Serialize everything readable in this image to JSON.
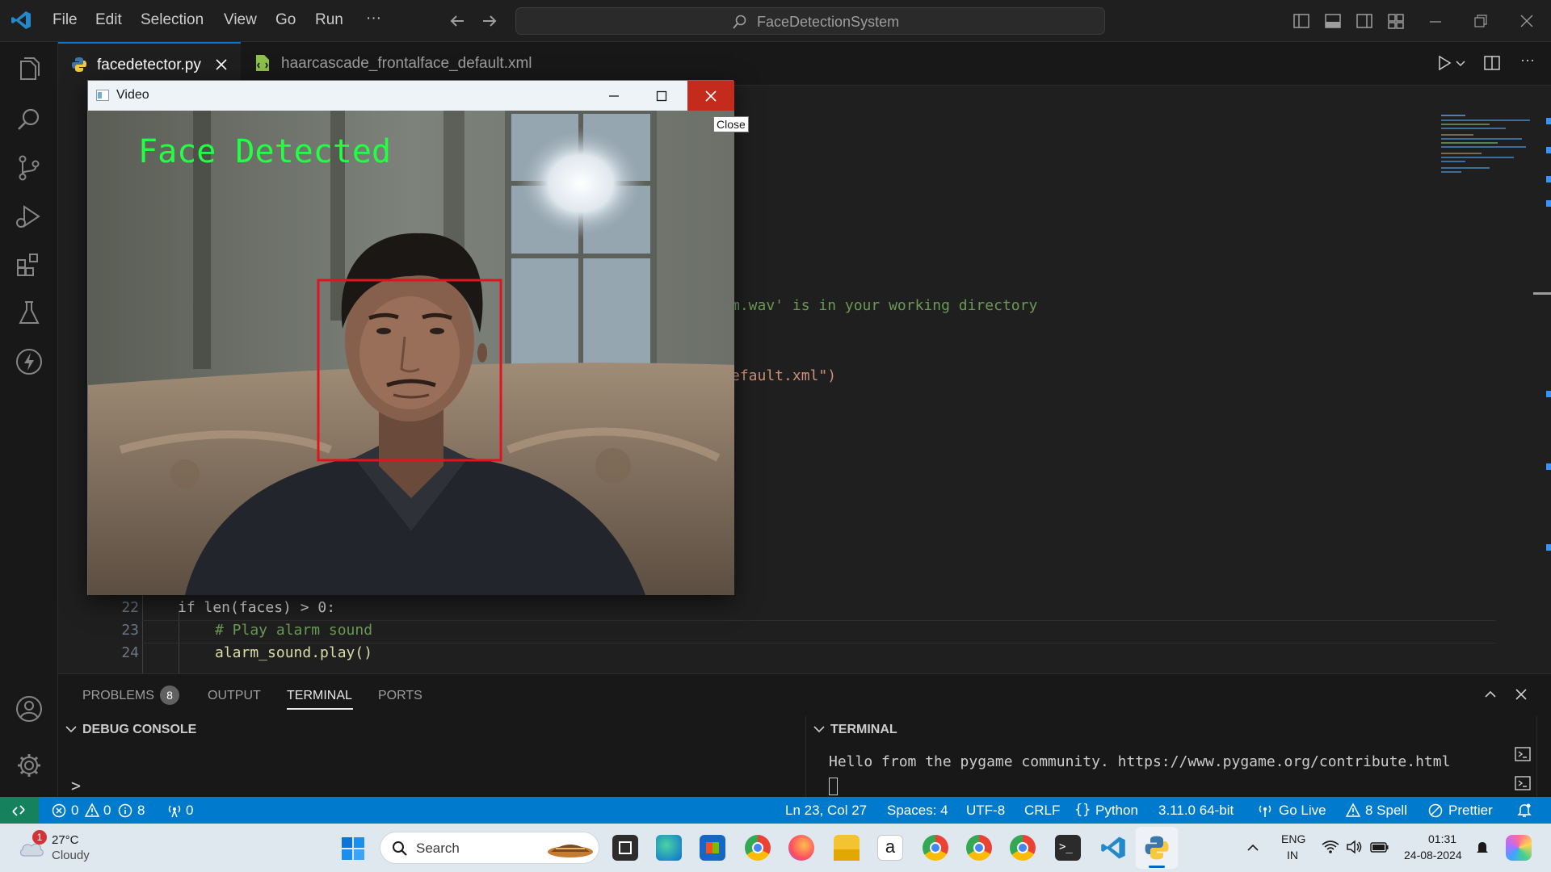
{
  "titlebar": {
    "menu": [
      "File",
      "Edit",
      "Selection",
      "View",
      "Go",
      "Run",
      "···"
    ],
    "search_text": "FaceDetectionSystem"
  },
  "tabs": [
    {
      "label": "facedetector.py",
      "active": true
    },
    {
      "label": "haarcascade_frontalface_default.xml",
      "active": false
    }
  ],
  "editor": {
    "visible_fragments": [
      "m.wav' is in your working directory",
      "efault.xml\")"
    ],
    "lines": [
      {
        "number": "22",
        "code": "if len(faces) > 0:"
      },
      {
        "number": "23",
        "code": "# Play alarm sound"
      },
      {
        "number": "24",
        "code": "alarm_sound.play()"
      }
    ]
  },
  "video_window": {
    "title": "Video",
    "close_tooltip": "Close",
    "overlay_text": "Face Detected",
    "box_color": "#e0141e",
    "text_color": "#22ff44"
  },
  "panel": {
    "tabs": [
      "PROBLEMS",
      "OUTPUT",
      "TERMINAL",
      "PORTS"
    ],
    "problems_count": "8",
    "active_tab": "TERMINAL",
    "debug_console_label": "DEBUG CONSOLE",
    "terminal_label": "TERMINAL",
    "prompt": ">",
    "terminal_output": "Hello from the pygame community. https://www.pygame.org/contribute.html"
  },
  "statusbar": {
    "errors": "0",
    "warnings": "0",
    "infos": "0",
    "info_count": "8",
    "ports": "0",
    "position": "Ln 23, Col 27",
    "spaces": "Spaces: 4",
    "encoding": "UTF-8",
    "eol": "CRLF",
    "language": "Python",
    "interpreter": "3.11.0 64-bit",
    "go_live": "Go Live",
    "spell": "8 Spell",
    "prettier": "Prettier",
    "accent": "#007acc"
  },
  "taskbar": {
    "weather_temp": "27°C",
    "weather_desc": "Cloudy",
    "weather_badge": "1",
    "search_placeholder": "Search",
    "lang_top": "ENG",
    "lang_bottom": "IN",
    "time": "01:31",
    "date": "24-08-2024"
  }
}
